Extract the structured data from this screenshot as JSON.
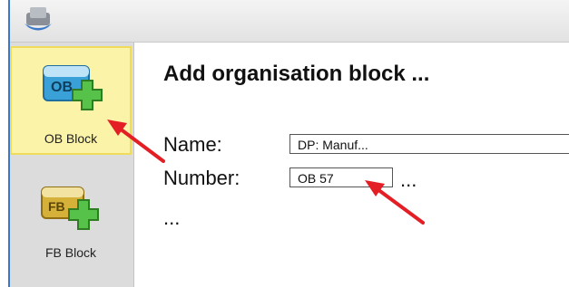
{
  "window": {
    "icon": "app-icon"
  },
  "sidebar": {
    "items": [
      {
        "label": "OB Block",
        "icon": "ob-block-icon",
        "selected": true,
        "icon_text": "OB"
      },
      {
        "label": "FB Block",
        "icon": "fb-block-icon",
        "selected": false,
        "icon_text": "FB"
      }
    ]
  },
  "dialog": {
    "title": "Add organisation block ...",
    "name_label": "Name:",
    "name_value": "DP: Manuf...",
    "number_label": "Number:",
    "number_value": "OB 57",
    "number_more": "...",
    "more_text": "..."
  },
  "colors": {
    "selected_bg": "#fbf3a8",
    "annotation_arrow": "#e41e25",
    "ob_icon": "#3aa0d8",
    "fb_icon": "#d6b13a",
    "plus": "#57c24a"
  }
}
